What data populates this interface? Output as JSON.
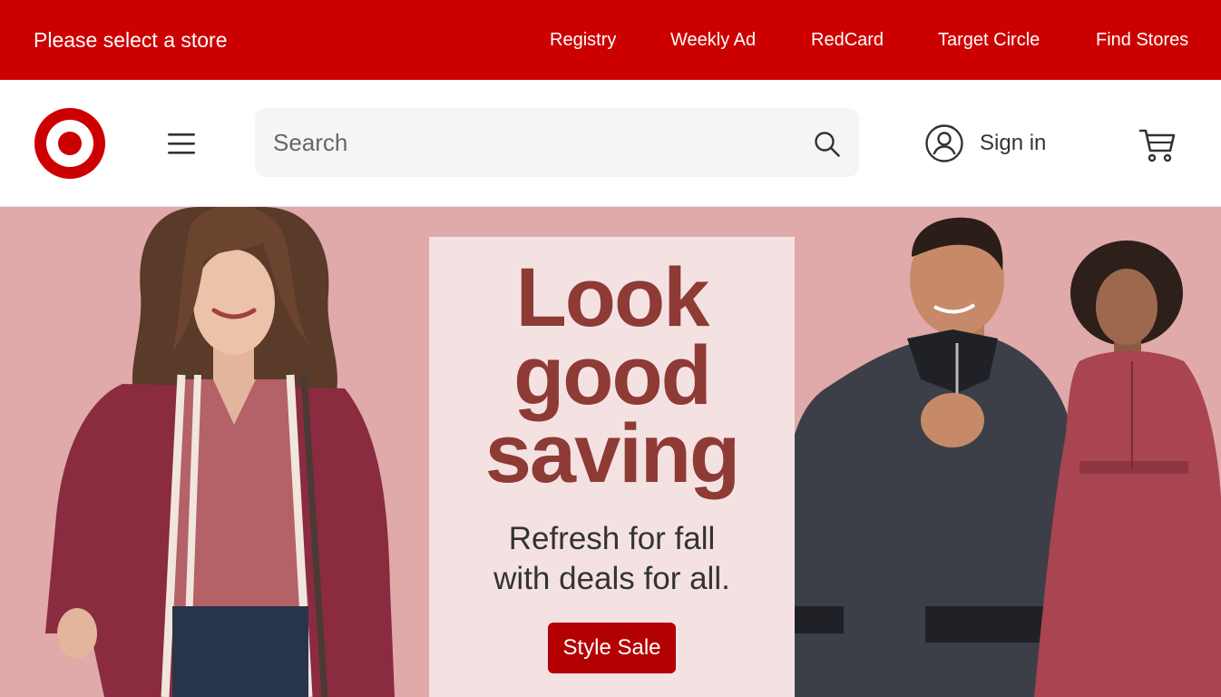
{
  "utility_bar": {
    "store_label": "Please select a store",
    "links": [
      {
        "label": "Registry"
      },
      {
        "label": "Weekly Ad"
      },
      {
        "label": "RedCard"
      },
      {
        "label": "Target Circle"
      },
      {
        "label": "Find Stores"
      }
    ]
  },
  "header": {
    "logo_icon": "target-bullseye-logo",
    "menu_icon": "hamburger-menu-icon",
    "search": {
      "placeholder": "Search",
      "value": "",
      "icon": "search-icon"
    },
    "sign_in_label": "Sign in",
    "account_icon": "user-circle-icon",
    "cart_icon": "shopping-cart-icon"
  },
  "hero": {
    "headline": [
      "Look",
      "good",
      "saving"
    ],
    "subtext": [
      "Refresh for fall",
      "with deals for all."
    ],
    "cta_label": "Style Sale",
    "images": [
      "woman in maroon knit cardigan",
      "man in gray quarter-zip sweater",
      "woman in rose belted dress"
    ]
  },
  "colors": {
    "brand_red": "#cc0000",
    "cta_red": "#b30000",
    "hero_background": "#e0a9aa",
    "promo_card": "#f4e2e3",
    "headline_text": "#8e3a35"
  }
}
